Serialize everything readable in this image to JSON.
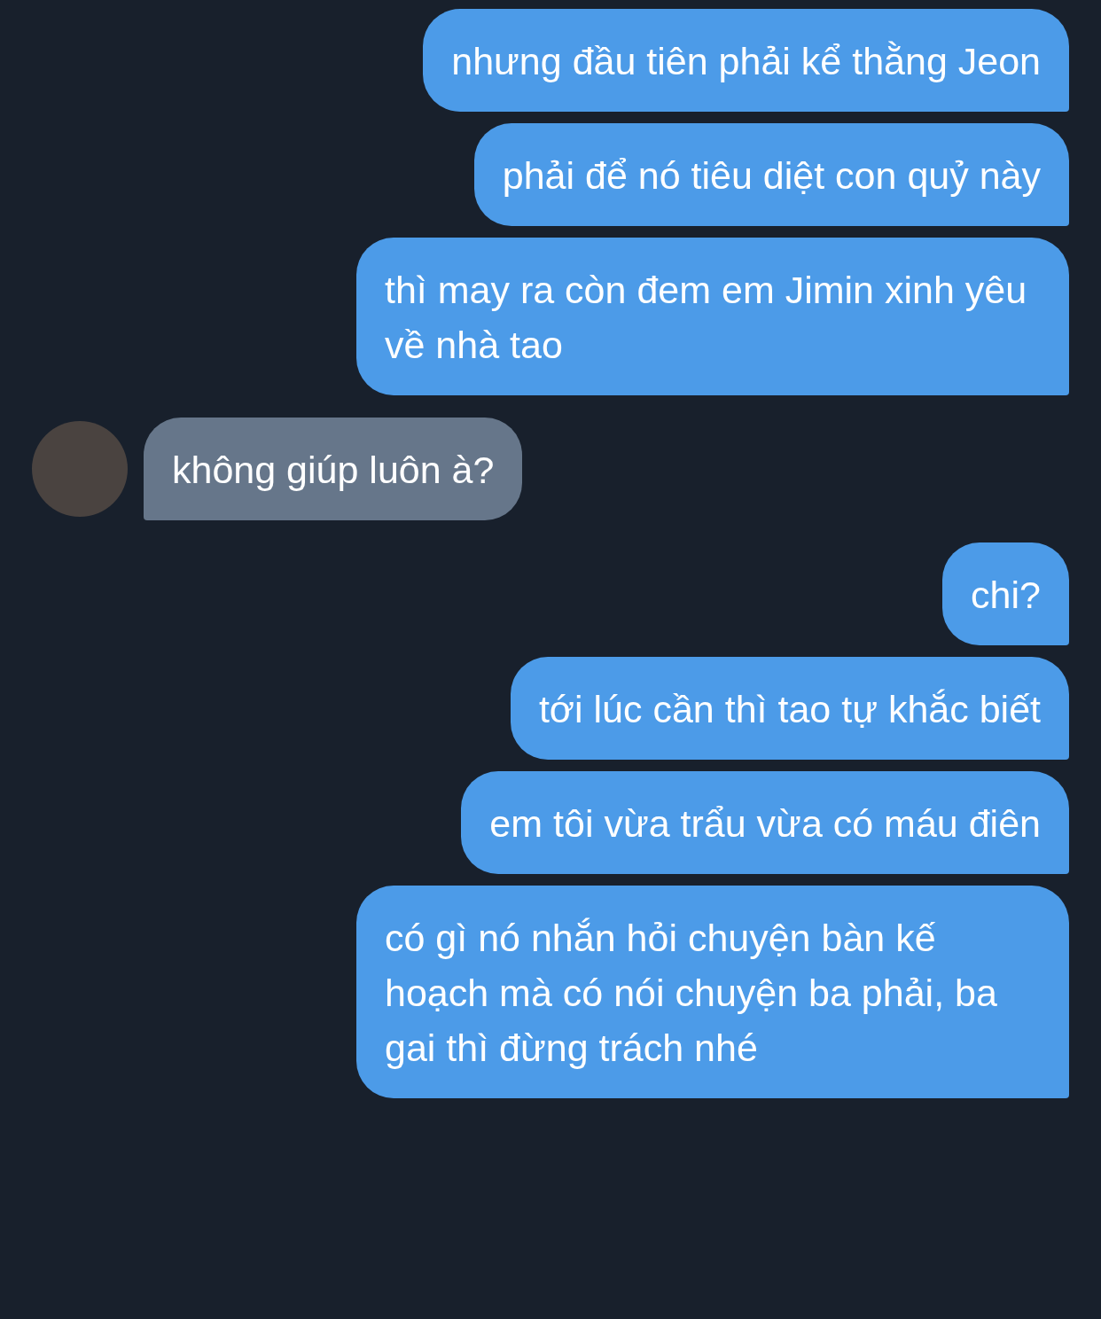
{
  "messages": [
    {
      "kind": "outgoing",
      "text": "nhưng đầu tiên phải kể thằng Jeon"
    },
    {
      "kind": "outgoing",
      "text": "phải để nó tiêu diệt con quỷ này"
    },
    {
      "kind": "outgoing",
      "text": "thì may ra còn đem em Jimin xinh yêu về nhà tao"
    },
    {
      "kind": "incoming",
      "text": "không giúp luôn à?"
    },
    {
      "kind": "outgoing",
      "text": "chi?"
    },
    {
      "kind": "outgoing",
      "text": "tới lúc cần thì tao tự khắc biết"
    },
    {
      "kind": "outgoing",
      "text": "em tôi vừa trẩu vừa có máu điên"
    },
    {
      "kind": "outgoing",
      "text": "có gì nó nhắn hỏi chuyện bàn kế hoạch mà có nói chuyện ba phải, ba gai thì đừng trách nhé"
    }
  ]
}
